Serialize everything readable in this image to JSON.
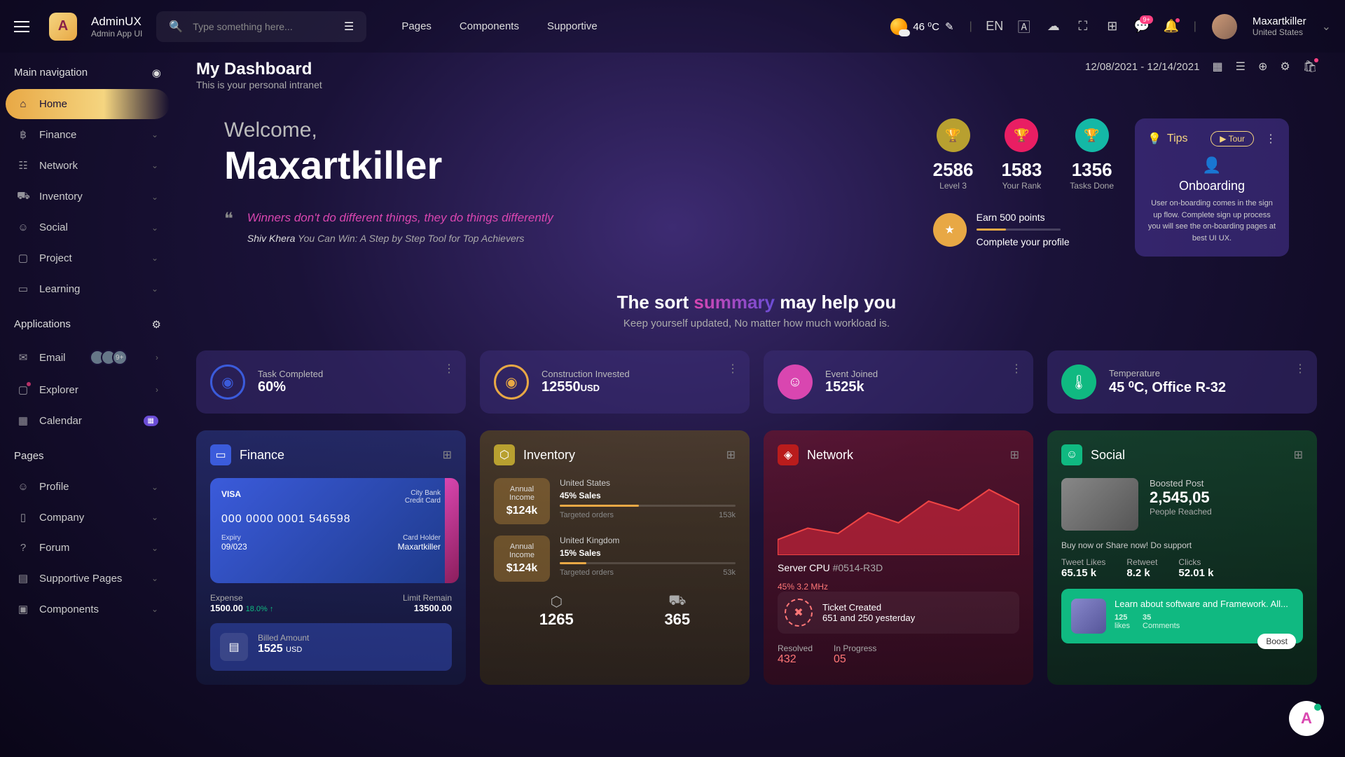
{
  "brand": {
    "title": "AdminUX",
    "subtitle": "Admin App UI",
    "logo": "A"
  },
  "search": {
    "placeholder": "Type something here..."
  },
  "topnav": [
    "Pages",
    "Components",
    "Supportive"
  ],
  "weather": {
    "temp": "46 ⁰C"
  },
  "lang": "EN",
  "notif_badge": "9+",
  "user": {
    "name": "Maxartkiller",
    "location": "United States"
  },
  "sidebar": {
    "nav_header": "Main navigation",
    "items": [
      {
        "label": "Home",
        "icon": "⌂",
        "active": true
      },
      {
        "label": "Finance",
        "icon": "฿",
        "chev": true
      },
      {
        "label": "Network",
        "icon": "☷",
        "chev": true
      },
      {
        "label": "Inventory",
        "icon": "⛟",
        "chev": true
      },
      {
        "label": "Social",
        "icon": "☺",
        "chev": true
      },
      {
        "label": "Project",
        "icon": "▢",
        "chev": true
      },
      {
        "label": "Learning",
        "icon": "▭",
        "chev": true
      }
    ],
    "apps_header": "Applications",
    "apps": [
      {
        "label": "Email",
        "icon": "✉",
        "avatars": true,
        "count": "9+",
        "chev": true
      },
      {
        "label": "Explorer",
        "icon": "▢",
        "chev": true,
        "dot": true
      },
      {
        "label": "Calendar",
        "icon": "▦",
        "pill": "▦"
      }
    ],
    "pages_header": "Pages",
    "pages": [
      {
        "label": "Profile",
        "icon": "☺",
        "chev": true
      },
      {
        "label": "Company",
        "icon": "▯",
        "chev": true
      },
      {
        "label": "Forum",
        "icon": "?",
        "chev": true
      },
      {
        "label": "Supportive Pages",
        "icon": "▤",
        "chev": true
      },
      {
        "label": "Components",
        "icon": "▣",
        "chev": true
      }
    ]
  },
  "page": {
    "title": "My Dashboard",
    "subtitle": "This is your personal intranet",
    "daterange": "12/08/2021 - 12/14/2021"
  },
  "welcome": {
    "greet": "Welcome,",
    "name": "Maxartkiller",
    "quote": "Winners don't do different things, they do things differently",
    "author": "Shiv Khera",
    "authorbook": "You Can Win: A Step by Step Tool for Top Achievers"
  },
  "stats": [
    {
      "val": "2586",
      "lbl": "Level 3",
      "color": "#b8a030"
    },
    {
      "val": "1583",
      "lbl": "Your Rank",
      "color": "#e91e63"
    },
    {
      "val": "1356",
      "lbl": "Tasks Done",
      "color": "#14b8a6"
    }
  ],
  "earn": {
    "title": "Earn 500 points",
    "sub": "Complete your profile",
    "progress": 35
  },
  "tips": {
    "label": "Tips",
    "tour": "Tour",
    "title": "Onboarding",
    "desc": "User on-boarding comes in the sign up flow. Complete sign up process you will see the on-boarding pages at best UI UX."
  },
  "summary": {
    "title_pre": "The sort ",
    "title_hl": "summary",
    "title_post": " may help you",
    "sub": "Keep yourself updated, No matter how much workload is."
  },
  "infocards": [
    {
      "lbl": "Task Completed",
      "val": "60%",
      "cls": "ic-blue",
      "icon": "◉"
    },
    {
      "lbl": "Construction Invested",
      "val": "12550",
      "unit": "USD",
      "cls": "ic-yellow",
      "icon": "◉"
    },
    {
      "lbl": "Event Joined",
      "val": "1525k",
      "cls": "ic-pink",
      "icon": "☺"
    },
    {
      "lbl": "Temperature",
      "val": "45 ⁰C, Office R-32",
      "cls": "ic-green",
      "icon": "🌡"
    }
  ],
  "finance": {
    "title": "Finance",
    "bank": "City Bank",
    "type": "Credit Card",
    "num": "000 0000 0001 546598",
    "exp_lbl": "Expiry",
    "exp": "09/023",
    "holder_lbl": "Card Holder",
    "holder": "Maxartkiller",
    "expense_lbl": "Expense",
    "expense": "1500.00",
    "pct": "18.0% ↑",
    "limit_lbl": "Limit Remain",
    "limit": "13500.00",
    "bill_lbl": "Billed Amount",
    "bill_val": "1525",
    "bill_unit": "USD"
  },
  "inventory": {
    "title": "Inventory",
    "items": [
      {
        "country": "United States",
        "sales": "45% Sales",
        "box_lbl": "Annual Income",
        "box_val": "$124k",
        "target_lbl": "Targeted orders",
        "target": "153k",
        "bar": 45
      },
      {
        "country": "United Kingdom",
        "sales": "15% Sales",
        "box_lbl": "Annual Income",
        "box_val": "$124k",
        "target_lbl": "Targeted orders",
        "target": "53k",
        "bar": 15
      }
    ],
    "bottom": [
      {
        "val": "1265",
        "icon": "⬡"
      },
      {
        "val": "365",
        "icon": "⛟"
      }
    ]
  },
  "network": {
    "title": "Network",
    "server_lbl": "Server CPU",
    "server_id": "#0514-R3D",
    "server_sub": "45% 3.2 MHz",
    "ticket_lbl": "Ticket Created",
    "ticket_val": "651 and 250 yesterday",
    "resolved_lbl": "Resolved",
    "resolved": "432",
    "progress_lbl": "In Progress",
    "progress": "05"
  },
  "chart_data": {
    "type": "area",
    "x": [
      0,
      1,
      2,
      3,
      4,
      5,
      6,
      7,
      8
    ],
    "values": [
      20,
      35,
      28,
      55,
      42,
      70,
      58,
      85,
      65
    ],
    "ylim": [
      0,
      100
    ]
  },
  "social": {
    "title": "Social",
    "boost_lbl": "Boosted Post",
    "boost_val": "2,545,05",
    "reach": "People Reached",
    "cta": "Buy now or Share now! Do support",
    "stats": [
      {
        "lbl": "Tweet Likes",
        "val": "65.15 k"
      },
      {
        "lbl": "Retweet",
        "val": "8.2 k"
      },
      {
        "lbl": "Clicks",
        "val": "52.01 k"
      }
    ],
    "learn": "Learn about software and Framework. All...",
    "learn_likes_lbl": "likes",
    "learn_likes": "125",
    "learn_comments_lbl": "Comments",
    "learn_comments": "35",
    "boost_btn": "Boost"
  }
}
